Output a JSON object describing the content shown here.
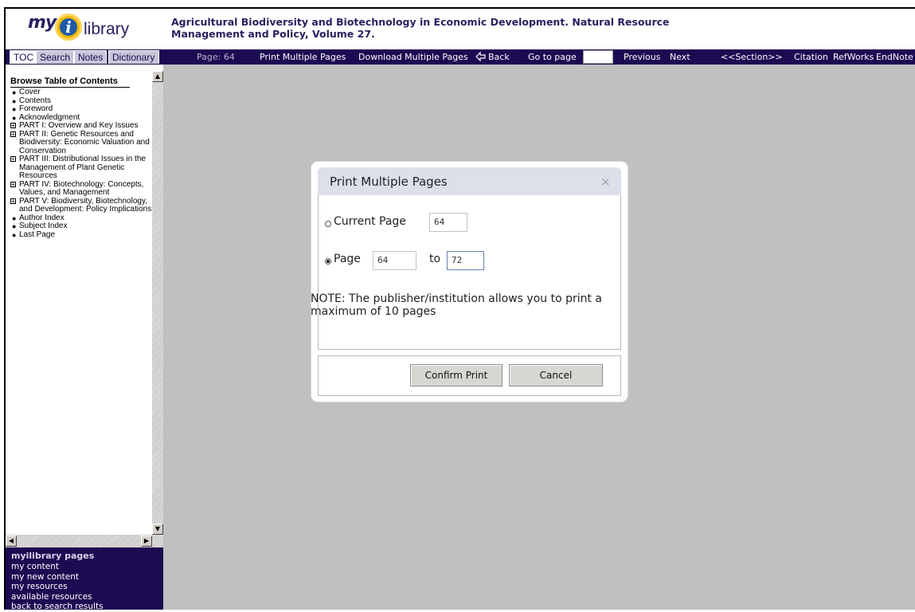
{
  "header": {
    "logo_my": "my",
    "logo_i": "i",
    "logo_library": "library",
    "book_title": "Agricultural Biodiversity and Biotechnology in Economic Development. Natural Resource Management and Policy, Volume 27."
  },
  "tabs": [
    {
      "label": "TOC",
      "active": true
    },
    {
      "label": "Search",
      "active": false
    },
    {
      "label": "Notes",
      "active": false
    },
    {
      "label": "Dictionary",
      "active": false
    }
  ],
  "toolbar": {
    "page_indicator": "Page: 64",
    "print_multiple": "Print Multiple Pages",
    "download_multiple": "Download Multiple Pages",
    "back": "Back",
    "go_to_page": "Go to page",
    "go_to_page_value": "",
    "previous": "Previous",
    "next": "Next",
    "section": "<<Section>>",
    "citation": "Citation",
    "refworks": "RefWorks",
    "endnote": "EndNote"
  },
  "toc": {
    "title": "Browse Table of Contents",
    "items": [
      {
        "label": "Cover",
        "type": "bullet"
      },
      {
        "label": "Contents",
        "type": "bullet"
      },
      {
        "label": "Foreword",
        "type": "bullet"
      },
      {
        "label": "Acknowledgment",
        "type": "bullet"
      },
      {
        "label": "PART I: Overview and Key Issues",
        "type": "expand"
      },
      {
        "label": "PART II: Genetic Resources and Biodiversity: Economic Valuation and Conservation",
        "type": "expand"
      },
      {
        "label": "PART III: Distributional Issues in the Management of Plant Genetic Resources",
        "type": "expand"
      },
      {
        "label": "PART IV: Biotechnology: Concepts, Values, and Management",
        "type": "expand"
      },
      {
        "label": "PART V: Biodiversity, Biotechnology, and Development: Policy Implications",
        "type": "expand"
      },
      {
        "label": "Author Index",
        "type": "bullet"
      },
      {
        "label": "Subject Index",
        "type": "bullet"
      },
      {
        "label": "Last Page",
        "type": "bullet"
      }
    ]
  },
  "mypages": {
    "title": "myilibrary pages",
    "links": [
      "my content",
      "my new content",
      "my resources",
      "available resources",
      "back to search results"
    ]
  },
  "modal": {
    "title": "Print Multiple Pages",
    "close": "×",
    "current_page_label": "Current Page",
    "current_page_value": "64",
    "current_page_checked": false,
    "page_label": "Page",
    "page_from": "64",
    "to_label": "to",
    "page_to": "72",
    "page_checked": true,
    "note": "NOTE: The publisher/institution allows you to print a maximum of 10 pages",
    "confirm_label": "Confirm Print",
    "cancel_label": "Cancel"
  },
  "icons": {
    "back": "back-arrow-icon",
    "expand": "plus-box-icon",
    "close": "close-icon"
  },
  "colors": {
    "nav_bg": "#1c0a52",
    "content_bg": "#c0c0c0",
    "logo_circle": "#f2b800",
    "modal_header": "#dde0ea"
  }
}
